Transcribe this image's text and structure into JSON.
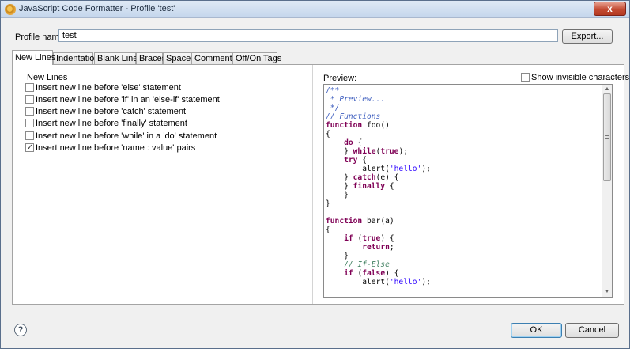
{
  "window": {
    "title": "JavaScript Code Formatter - Profile 'test'",
    "close_label": "x"
  },
  "profile": {
    "label": "Profile name:",
    "value": "test",
    "export_label": "Export..."
  },
  "tabs": [
    {
      "label": "New Lines",
      "active": true
    },
    {
      "label": "Indentation"
    },
    {
      "label": "Blank Lines"
    },
    {
      "label": "Braces"
    },
    {
      "label": "Spaces"
    },
    {
      "label": "Comments"
    },
    {
      "label": "Off/On Tags"
    }
  ],
  "new_lines": {
    "group_label": "New Lines",
    "options": [
      {
        "label": "Insert new line before 'else' statement",
        "checked": false
      },
      {
        "label": "Insert new line before 'if' in an 'else-if' statement",
        "checked": false
      },
      {
        "label": "Insert new line before 'catch' statement",
        "checked": false
      },
      {
        "label": "Insert new line before 'finally' statement",
        "checked": false
      },
      {
        "label": "Insert new line before 'while' in a 'do' statement",
        "checked": false
      },
      {
        "label": "Insert new line before 'name : value' pairs",
        "checked": true
      }
    ]
  },
  "preview": {
    "label": "Preview:",
    "show_invisible_label": "Show invisible characters",
    "show_invisible_checked": false,
    "code_lines": [
      "/**",
      " * Preview...",
      " */",
      "// Functions",
      "function foo()",
      "{",
      "    do {",
      "    } while(true);",
      "    try {",
      "        alert('hello');",
      "    } catch(e) {",
      "    } finally {",
      "    }",
      "}",
      "",
      "function bar(a)",
      "{",
      "    if (true) {",
      "        return;",
      "    }",
      "    // If-Else",
      "    if (false) {",
      "        alert('hello');"
    ]
  },
  "footer": {
    "help_symbol": "?",
    "ok_label": "OK",
    "cancel_label": "Cancel"
  }
}
